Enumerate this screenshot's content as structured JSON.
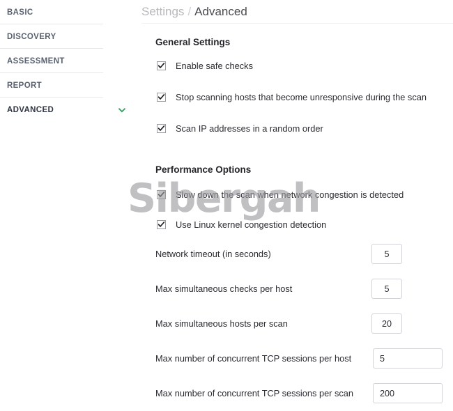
{
  "sidebar": {
    "items": [
      {
        "label": "BASIC",
        "active": false,
        "chevron": false
      },
      {
        "label": "DISCOVERY",
        "active": false,
        "chevron": false
      },
      {
        "label": "ASSESSMENT",
        "active": false,
        "chevron": false
      },
      {
        "label": "REPORT",
        "active": false,
        "chevron": false
      },
      {
        "label": "ADVANCED",
        "active": true,
        "chevron": true
      }
    ],
    "chevron_icon": "chevron-down-icon",
    "chevron_color": "#3aa063"
  },
  "breadcrumb": {
    "root": "Settings",
    "separator": "/",
    "current": "Advanced"
  },
  "watermark": {
    "text": "Sibergah"
  },
  "sections": [
    {
      "title": "General Settings",
      "checkboxes": [
        {
          "label": "Enable safe checks",
          "checked": true
        },
        {
          "label": "Stop scanning hosts that become unresponsive during the scan",
          "checked": true
        },
        {
          "label": "Scan IP addresses in a random order",
          "checked": true
        }
      ]
    },
    {
      "title": "Performance Options",
      "checkboxes": [
        {
          "label": "Slow down the scan when network congestion is detected",
          "checked": true
        },
        {
          "label": "Use Linux kernel congestion detection",
          "checked": true
        }
      ],
      "fields": [
        {
          "label": "Network timeout (in seconds)",
          "value": "5",
          "width": "narrow"
        },
        {
          "label": "Max simultaneous checks per host",
          "value": "5",
          "width": "narrow"
        },
        {
          "label": "Max simultaneous hosts per scan",
          "value": "20",
          "width": "narrow"
        },
        {
          "label": "Max number of concurrent TCP sessions per host",
          "value": "5",
          "width": "wide"
        },
        {
          "label": "Max number of concurrent TCP sessions per scan",
          "value": "200",
          "width": "wide"
        }
      ]
    }
  ],
  "colors": {
    "accent_green": "#3aa063",
    "text_primary": "#2b2b31",
    "text_muted": "#b8b8bc",
    "nav_text": "#5a6270",
    "border": "#d3d3d7"
  }
}
